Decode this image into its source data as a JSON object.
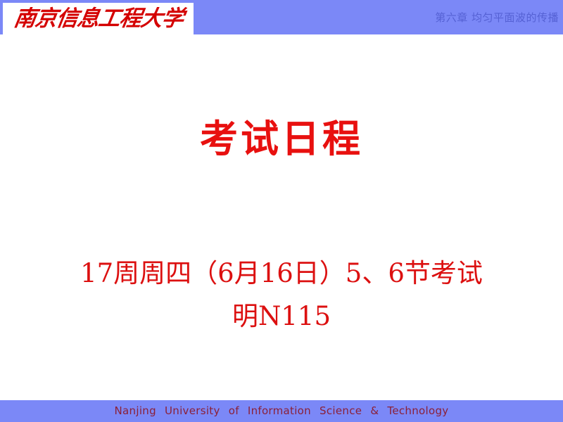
{
  "slide": {
    "background_color": "#ffffff",
    "band_color": "#7b88f7"
  },
  "header": {
    "logo_text": "南京信息工程大学",
    "logo_color": "#d40000",
    "chapter_label": "第六章 均匀平面波的传播",
    "chapter_color": "#5561d4"
  },
  "main": {
    "title": "考试日程",
    "title_color": "#e8100f",
    "lines": [
      "17周周四（6月16日）5、6节考试",
      "明N115"
    ],
    "line_color": "#dc1010"
  },
  "footer": {
    "text": "Nanjing University of Information Science & Technology",
    "text_color": "#8b2038"
  }
}
